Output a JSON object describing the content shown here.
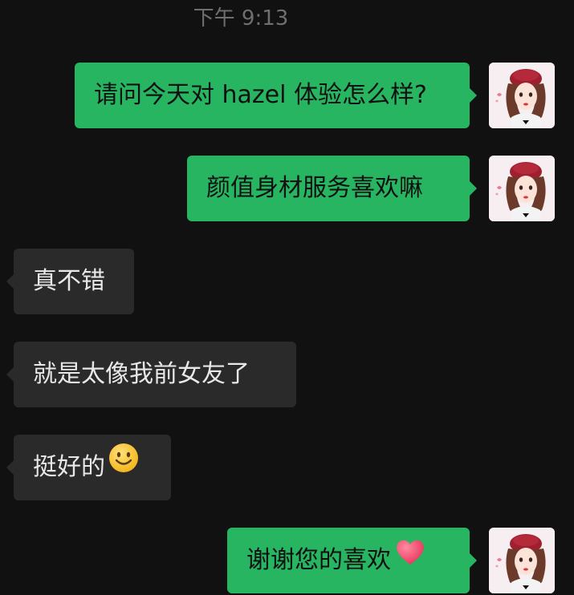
{
  "status": {
    "timestamp": "下午 9:13"
  },
  "messages": [
    {
      "sender": "me",
      "text": "请问今天对 hazel 体验怎么样?"
    },
    {
      "sender": "me",
      "text": "颜值身材服务喜欢嘛"
    },
    {
      "sender": "other",
      "text": "真不错"
    },
    {
      "sender": "other",
      "text": "就是太像我前女友了"
    },
    {
      "sender": "other",
      "text": "挺好的",
      "emoji": "smiling-face-emoji"
    },
    {
      "sender": "me",
      "text": "谢谢您的喜欢",
      "emoji": "red-heart-emoji"
    }
  ],
  "colors": {
    "background": "#111111",
    "outgoing_bubble": "#27b562",
    "incoming_bubble": "#2a2a2a",
    "timestamp_text": "#6f6f6f"
  }
}
